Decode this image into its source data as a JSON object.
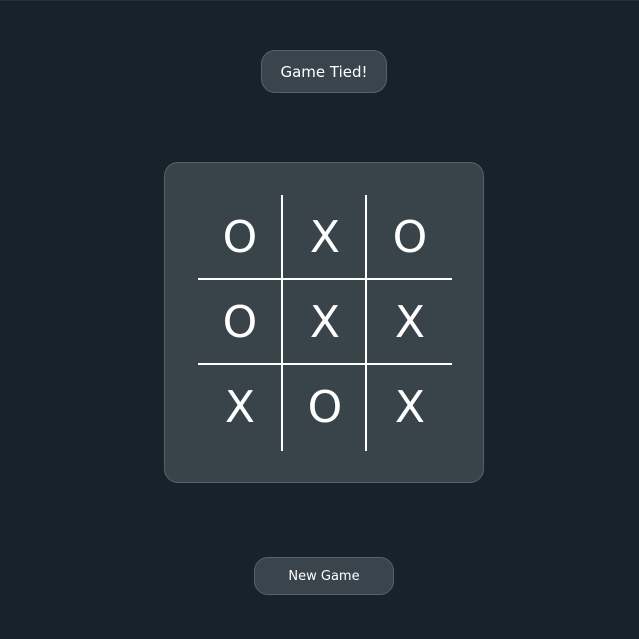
{
  "status": {
    "text": "Game Tied!"
  },
  "board": {
    "cells": [
      "O",
      "X",
      "O",
      "O",
      "X",
      "X",
      "X",
      "O",
      "X"
    ]
  },
  "controls": {
    "new_game_label": "New Game"
  },
  "colors": {
    "background": "#17232b",
    "panel": "#39444a",
    "panel_border": "#56616a",
    "text": "#ffffff"
  }
}
